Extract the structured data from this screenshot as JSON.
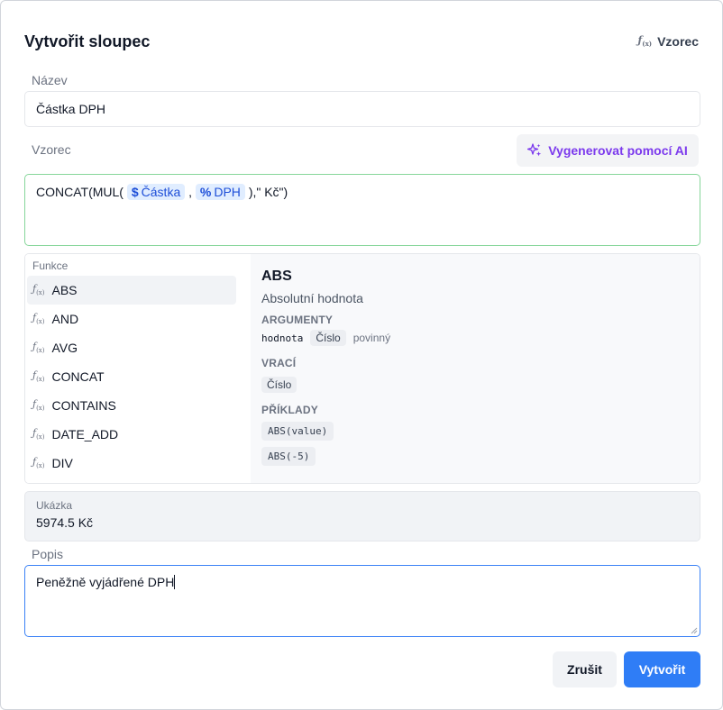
{
  "dialog": {
    "title": "Vytvořit sloupec",
    "mode_toggle": "Vzorec",
    "fx_icon": "function-icon"
  },
  "name_field": {
    "label": "Název",
    "value": "Částka DPH"
  },
  "formula_field": {
    "label": "Vzorec",
    "ai_button": "Vygenerovat pomocí AI",
    "parts": {
      "prefix": "CONCAT(MUL(",
      "chip1_symbol": "$",
      "chip1_label": "Částka",
      "separator": ",",
      "chip2_symbol": "%",
      "chip2_label": "DPH",
      "suffix": "),\" Kč\")"
    }
  },
  "functions": {
    "title": "Funkce",
    "items": [
      "ABS",
      "AND",
      "AVG",
      "CONCAT",
      "CONTAINS",
      "DATE_ADD",
      "DIV"
    ],
    "selected": "ABS"
  },
  "detail": {
    "name": "ABS",
    "description": "Absolutní hodnota",
    "arguments_label": "ARGUMENTY",
    "arg_name": "hodnota",
    "arg_type": "Číslo",
    "arg_required": "povinný",
    "returns_label": "VRACÍ",
    "returns_type": "Číslo",
    "examples_label": "PŘÍKLADY",
    "examples": [
      "ABS(value)",
      "ABS(-5)"
    ]
  },
  "preview": {
    "label": "Ukázka",
    "value": "5974.5 Kč"
  },
  "description_field": {
    "label": "Popis",
    "value": "Peněžně vyjádřené DPH"
  },
  "buttons": {
    "cancel": "Zrušit",
    "create": "Vytvořit"
  },
  "colors": {
    "primary": "#2f7df6",
    "ai": "#7c3aed",
    "chip": "#e0edff",
    "formula_border": "#86d69a"
  }
}
